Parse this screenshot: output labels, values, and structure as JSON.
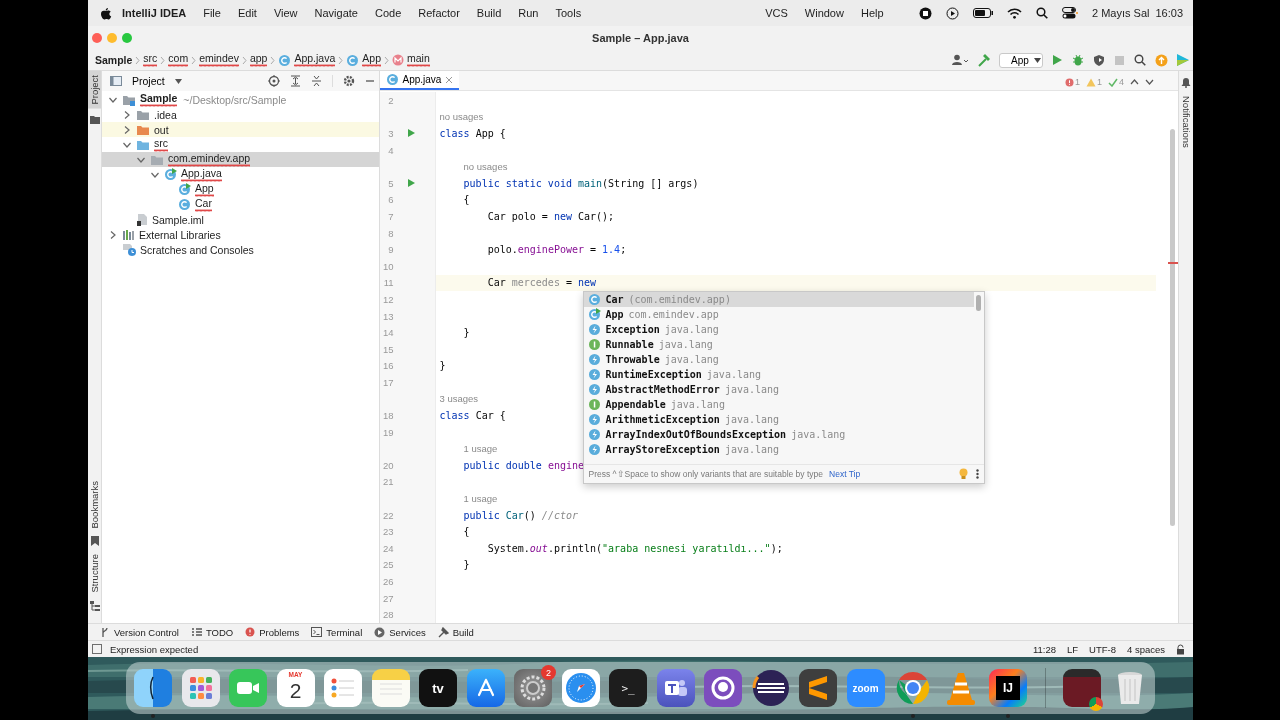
{
  "menu_bar": {
    "app_name": "IntelliJ IDEA",
    "menus": [
      "File",
      "Edit",
      "View",
      "Navigate",
      "Code",
      "Refactor",
      "Build",
      "Run",
      "Tools"
    ],
    "menus_after_notch": [
      "VCS",
      "Window",
      "Help"
    ],
    "date": "2 Mayıs Sal",
    "time": "16:03"
  },
  "window": {
    "title": "Sample – App.java"
  },
  "breadcrumbs": [
    {
      "text": "Sample",
      "kind": "project",
      "error": false
    },
    {
      "text": "src",
      "kind": "folder",
      "error": true
    },
    {
      "text": "com",
      "kind": "folder",
      "error": true
    },
    {
      "text": "emindev",
      "kind": "folder",
      "error": true
    },
    {
      "text": "app",
      "kind": "folder",
      "error": true
    },
    {
      "text": "App.java",
      "kind": "class",
      "error": true
    },
    {
      "text": "App",
      "kind": "class",
      "error": true
    },
    {
      "text": "main",
      "kind": "method",
      "error": true
    }
  ],
  "run_config": "App",
  "left_stripe": {
    "top": [
      {
        "label": "Project",
        "selected": true
      }
    ],
    "bottom": [
      {
        "label": "Bookmarks",
        "selected": false
      },
      {
        "label": "Structure",
        "selected": false
      }
    ]
  },
  "right_stripe": [
    {
      "label": "Notifications",
      "selected": false
    }
  ],
  "project_panel": {
    "title": "Project",
    "tree": [
      {
        "label": "Sample",
        "hint": "~/Desktop/src/Sample",
        "kind": "module",
        "expanded": true,
        "selected": false,
        "error": true,
        "children": [
          {
            "label": ".idea",
            "kind": "folder",
            "expanded": false,
            "selected": false,
            "error": false
          },
          {
            "label": "out",
            "kind": "excluded-folder",
            "expanded": false,
            "selected": false,
            "error": false
          },
          {
            "label": "src",
            "kind": "source-folder",
            "expanded": true,
            "selected": false,
            "error": true,
            "children": [
              {
                "label": "com.emindev.app",
                "kind": "package",
                "expanded": true,
                "selected": true,
                "error": true,
                "children": [
                  {
                    "label": "App.java",
                    "kind": "java-file",
                    "expanded": true,
                    "selected": false,
                    "error": true,
                    "children": [
                      {
                        "label": "App",
                        "kind": "runnable-class",
                        "selected": false,
                        "error": true
                      },
                      {
                        "label": "Car",
                        "kind": "class",
                        "selected": false,
                        "error": true
                      }
                    ]
                  }
                ]
              }
            ]
          },
          {
            "label": "Sample.iml",
            "kind": "iml-file",
            "selected": false,
            "error": false
          }
        ]
      },
      {
        "label": "External Libraries",
        "kind": "libraries",
        "expanded": false,
        "selected": false,
        "error": false
      },
      {
        "label": "Scratches and Consoles",
        "kind": "scratches",
        "selected": false,
        "error": false
      }
    ]
  },
  "editor": {
    "tabs": [
      {
        "label": "App.java",
        "selected": true
      }
    ],
    "inspections": [
      {
        "kind": "error",
        "count": "1"
      },
      {
        "kind": "warning",
        "count": "1"
      },
      {
        "kind": "weak",
        "count": "4"
      }
    ],
    "lines": [
      {
        "number": "2",
        "current": false,
        "run": false
      },
      {
        "number": "3",
        "current": false,
        "run": true,
        "inlay": "no usages",
        "tokens": [
          {
            "kind": "keyword",
            "text": "class"
          },
          {
            "kind": "plain",
            "text": " App {"
          }
        ]
      },
      {
        "number": "4",
        "current": false,
        "run": false
      },
      {
        "number": "5",
        "current": false,
        "run": true,
        "inlay": "no usages",
        "tokens": [
          {
            "kind": "keyword",
            "text": "    public static void "
          },
          {
            "kind": "method",
            "text": "main"
          },
          {
            "kind": "plain",
            "text": "(String [] args)"
          }
        ]
      },
      {
        "number": "6",
        "current": false,
        "run": false,
        "tokens": [
          {
            "kind": "plain",
            "text": "    {"
          }
        ]
      },
      {
        "number": "7",
        "current": false,
        "run": false,
        "tokens": [
          {
            "kind": "plain",
            "text": "        Car polo = "
          },
          {
            "kind": "keyword",
            "text": "new"
          },
          {
            "kind": "plain",
            "text": " Car();"
          }
        ]
      },
      {
        "number": "8",
        "current": false,
        "run": false
      },
      {
        "number": "9",
        "current": false,
        "run": false,
        "tokens": [
          {
            "kind": "plain",
            "text": "        polo."
          },
          {
            "kind": "field",
            "text": "enginePower"
          },
          {
            "kind": "plain",
            "text": " = "
          },
          {
            "kind": "number",
            "text": "1.4"
          },
          {
            "kind": "plain",
            "text": ";"
          }
        ]
      },
      {
        "number": "10",
        "current": false,
        "run": false
      },
      {
        "number": "11",
        "current": true,
        "run": false,
        "tokens": [
          {
            "kind": "plain",
            "text": "        Car "
          },
          {
            "kind": "unused",
            "text": "mercedes"
          },
          {
            "kind": "plain",
            "text": " = "
          },
          {
            "kind": "keyword",
            "text": "new"
          }
        ]
      },
      {
        "number": "12",
        "current": false,
        "run": false
      },
      {
        "number": "13",
        "current": false,
        "run": false
      },
      {
        "number": "14",
        "current": false,
        "run": false,
        "tokens": [
          {
            "kind": "plain",
            "text": "    }"
          }
        ]
      },
      {
        "number": "15",
        "current": false,
        "run": false
      },
      {
        "number": "16",
        "current": false,
        "run": false,
        "tokens": [
          {
            "kind": "plain",
            "text": "}"
          }
        ]
      },
      {
        "number": "17",
        "current": false,
        "run": false
      },
      {
        "number": "18",
        "current": false,
        "run": false,
        "inlay": "3 usages",
        "tokens": [
          {
            "kind": "keyword",
            "text": "class"
          },
          {
            "kind": "plain",
            "text": " Car {"
          }
        ]
      },
      {
        "number": "19",
        "current": false,
        "run": false
      },
      {
        "number": "20",
        "current": false,
        "run": false,
        "inlay": "1 usage",
        "tokens": [
          {
            "kind": "keyword",
            "text": "    public double "
          },
          {
            "kind": "field",
            "text": "engine"
          }
        ]
      },
      {
        "number": "21",
        "current": false,
        "run": false
      },
      {
        "number": "22",
        "current": false,
        "run": false,
        "inlay": "1 usage",
        "tokens": [
          {
            "kind": "keyword",
            "text": "    public "
          },
          {
            "kind": "method",
            "text": "Car"
          },
          {
            "kind": "plain",
            "text": "() "
          },
          {
            "kind": "comment",
            "text": "//ctor"
          }
        ]
      },
      {
        "number": "23",
        "current": false,
        "run": false,
        "tokens": [
          {
            "kind": "plain",
            "text": "    {"
          }
        ]
      },
      {
        "number": "24",
        "current": false,
        "run": false,
        "tokens": [
          {
            "kind": "plain",
            "text": "        System."
          },
          {
            "kind": "static-field",
            "text": "out"
          },
          {
            "kind": "plain",
            "text": ".println("
          },
          {
            "kind": "string",
            "text": "\"araba nesnesi yaratıldı...\""
          },
          {
            "kind": "plain",
            "text": ");"
          }
        ]
      },
      {
        "number": "25",
        "current": false,
        "run": false,
        "tokens": [
          {
            "kind": "plain",
            "text": "    }"
          }
        ]
      },
      {
        "number": "26",
        "current": false,
        "run": false
      },
      {
        "number": "27",
        "current": false,
        "run": false
      },
      {
        "number": "28",
        "current": false,
        "run": false
      }
    ],
    "completion": {
      "items": [
        {
          "kind": "class",
          "name": "Car",
          "package": "(com.emindev.app)",
          "selected": true
        },
        {
          "kind": "runnable-class",
          "name": "App",
          "package": "com.emindev.app",
          "selected": false
        },
        {
          "kind": "exception",
          "name": "Exception",
          "package": "java.lang",
          "selected": false
        },
        {
          "kind": "interface",
          "name": "Runnable",
          "package": "java.lang",
          "selected": false
        },
        {
          "kind": "exception",
          "name": "Throwable",
          "package": "java.lang",
          "selected": false
        },
        {
          "kind": "exception",
          "name": "RuntimeException",
          "package": "java.lang",
          "selected": false
        },
        {
          "kind": "exception",
          "name": "AbstractMethodError",
          "package": "java.lang",
          "selected": false
        },
        {
          "kind": "interface",
          "name": "Appendable",
          "package": "java.lang",
          "selected": false
        },
        {
          "kind": "exception",
          "name": "ArithmeticException",
          "package": "java.lang",
          "selected": false
        },
        {
          "kind": "exception",
          "name": "ArrayIndexOutOfBoundsException",
          "package": "java.lang",
          "selected": false
        },
        {
          "kind": "exception",
          "name": "ArrayStoreException",
          "package": "java.lang",
          "selected": false
        }
      ],
      "hint": "Press ^⇧Space to show only variants that are suitable by type",
      "link": "Next Tip"
    }
  },
  "tool_windows": [
    {
      "label": "Version Control",
      "kind": "vcs"
    },
    {
      "label": "TODO",
      "kind": "todo"
    },
    {
      "label": "Problems",
      "kind": "problems"
    },
    {
      "label": "Terminal",
      "kind": "terminal"
    },
    {
      "label": "Services",
      "kind": "services"
    },
    {
      "label": "Build",
      "kind": "build"
    }
  ],
  "status_bar": {
    "message": "Expression expected",
    "items": [
      "11:28",
      "LF",
      "UTF-8",
      "4 spaces"
    ]
  },
  "dock": {
    "apps": [
      {
        "kind": "finder",
        "running": true
      },
      {
        "kind": "launchpad",
        "running": false
      },
      {
        "kind": "facetime",
        "running": false
      },
      {
        "kind": "calendar",
        "text": "MAY",
        "subtext": "2",
        "running": false
      },
      {
        "kind": "reminders",
        "running": false
      },
      {
        "kind": "notes",
        "running": false
      },
      {
        "kind": "tv",
        "text": "tv",
        "running": false
      },
      {
        "kind": "appstore",
        "running": false
      },
      {
        "kind": "settings",
        "badge": "2",
        "running": false
      },
      {
        "kind": "safari",
        "running": false
      },
      {
        "kind": "terminal",
        "text": ">_",
        "running": false
      },
      {
        "kind": "teams",
        "running": false
      },
      {
        "kind": "github",
        "running": false
      },
      {
        "kind": "eclipse",
        "running": false
      },
      {
        "kind": "sublime",
        "running": false
      },
      {
        "kind": "zoom",
        "text": "zoom",
        "running": false
      },
      {
        "kind": "chrome",
        "running": true
      },
      {
        "kind": "vlc",
        "running": false
      },
      {
        "kind": "intellij",
        "text": "IJ",
        "running": true
      }
    ],
    "others": [
      {
        "kind": "thumbnail",
        "running": false
      },
      {
        "kind": "trash",
        "running": false
      }
    ]
  }
}
